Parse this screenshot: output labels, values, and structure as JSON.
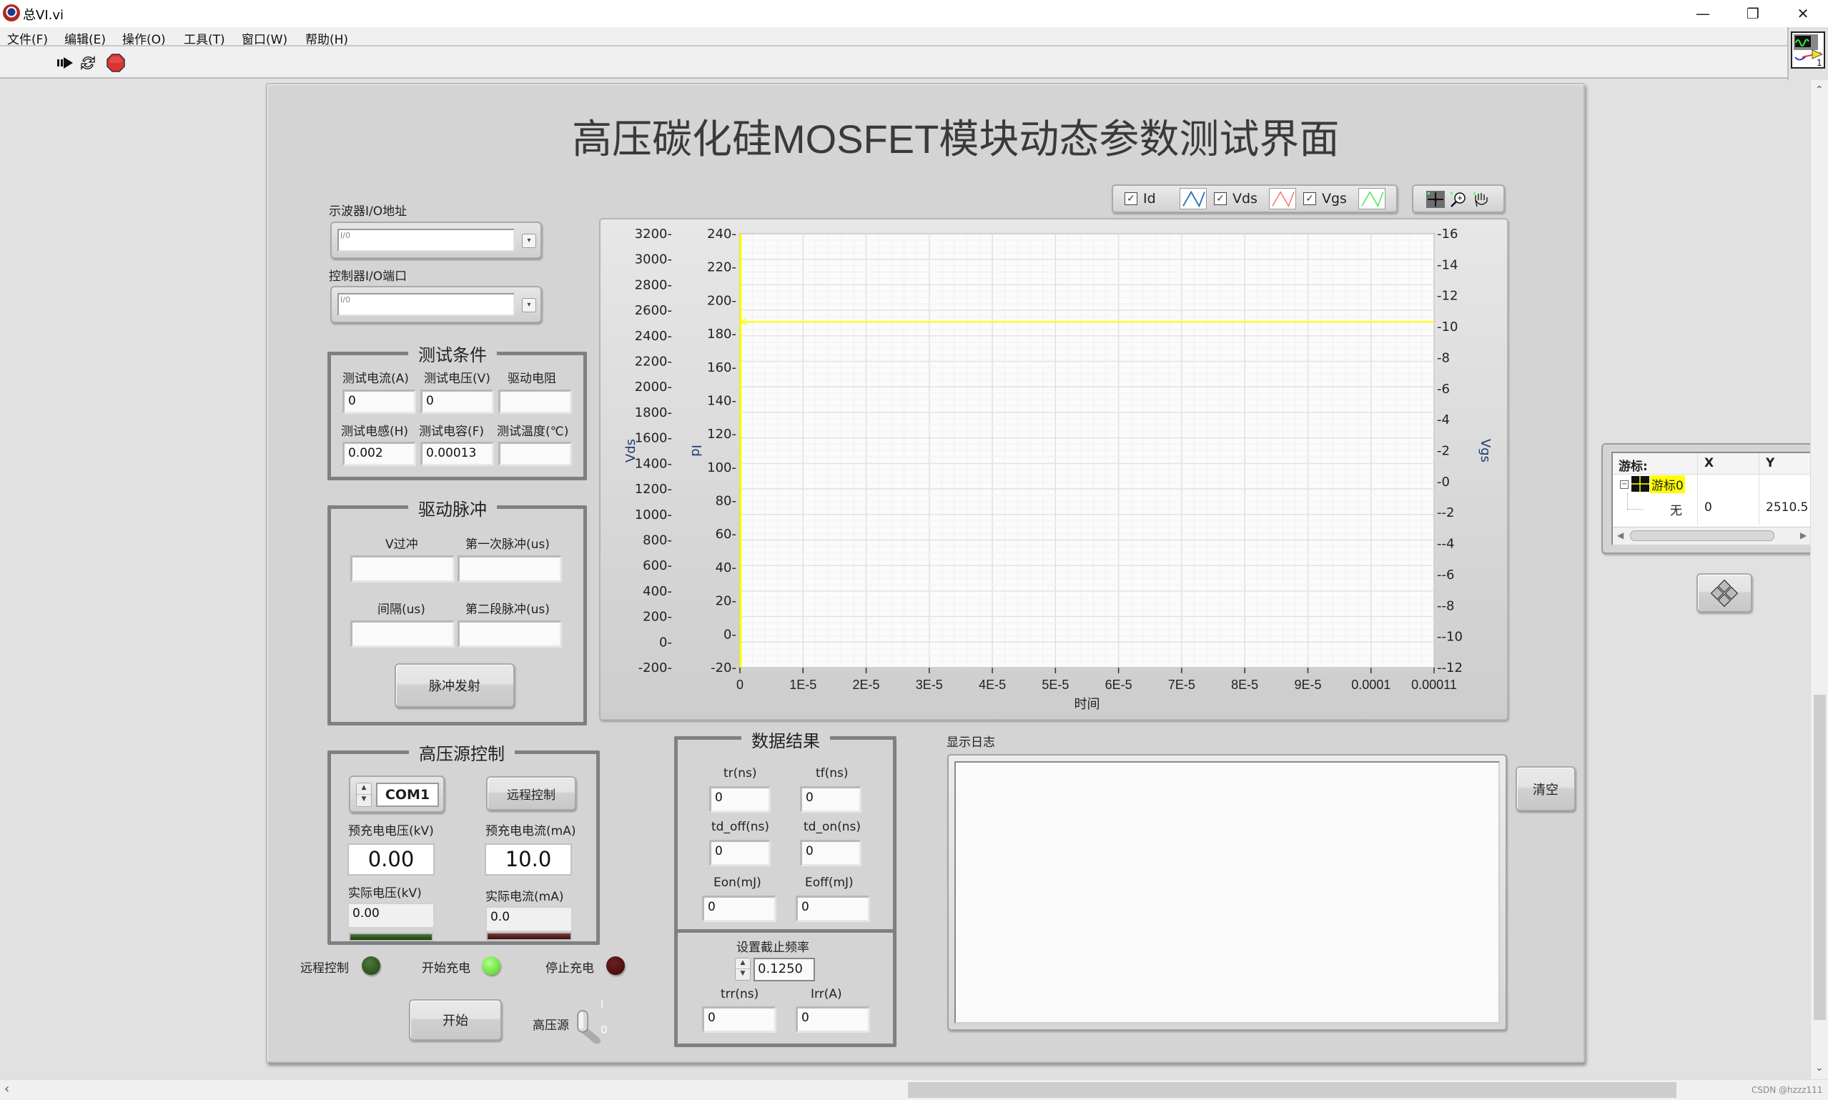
{
  "window": {
    "title": "总VI.vi",
    "controls": {
      "minimize": "—",
      "restore": "❐",
      "close": "✕"
    }
  },
  "menu": [
    "文件(F)",
    "编辑(E)",
    "操作(O)",
    "工具(T)",
    "窗口(W)",
    "帮助(H)"
  ],
  "toolbar": {
    "run_icon": "run-arrow-icon",
    "run_continuous_icon": "run-continuously-icon",
    "abort_icon": "abort-stop-icon"
  },
  "panel": {
    "title": "高压碳化硅MOSFET模块动态参数测试界面"
  },
  "io": {
    "scope_label": "示波器I/O地址",
    "scope_value": "",
    "controller_label": "控制器I/O端口",
    "controller_value": "",
    "io_glyph": "I/0"
  },
  "test_conditions": {
    "title": "测试条件",
    "fields": [
      {
        "label": "测试电流(A)",
        "value": "0"
      },
      {
        "label": "测试电压(V)",
        "value": "0"
      },
      {
        "label": "驱动电阻",
        "value": ""
      },
      {
        "label": "测试电感(H)",
        "value": "0.002"
      },
      {
        "label": "测试电容(F)",
        "value": "0.00013"
      },
      {
        "label": "测试温度(℃)",
        "value": ""
      }
    ]
  },
  "drive_pulse": {
    "title": "驱动脉冲",
    "fields": [
      {
        "label": "V过冲",
        "value": ""
      },
      {
        "label": "第一次脉冲(us)",
        "value": ""
      },
      {
        "label": "间隔(us)",
        "value": ""
      },
      {
        "label": "第二段脉冲(us)",
        "value": ""
      }
    ],
    "fire_button": "脉冲发射"
  },
  "hv_control": {
    "title": "高压源控制",
    "com_port": "COM1",
    "remote_button": "远程控制",
    "precharge_voltage_label": "预充电电压(kV)",
    "precharge_voltage": "0.00",
    "precharge_current_label": "预充电电流(mA)",
    "precharge_current": "10.0",
    "actual_voltage_label": "实际电压(kV)",
    "actual_voltage": "0.00",
    "actual_current_label": "实际电流(mA)",
    "actual_current": "0.0",
    "voltage_bar_fraction": 0,
    "current_bar_fraction": 0
  },
  "indicators": [
    {
      "label": "远程控制",
      "state": "off",
      "color": "#2e5a1e"
    },
    {
      "label": "开始充电",
      "state": "on",
      "color": "#5cf02a"
    },
    {
      "label": "停止充电",
      "state": "off",
      "color": "#4a1010"
    }
  ],
  "start_button": "开始",
  "hv_switch": {
    "label": "高压源",
    "on_label": "I",
    "off_label": "0",
    "state": "off"
  },
  "results": {
    "title": "数据结果",
    "fields": [
      {
        "label": "tr(ns)",
        "value": "0"
      },
      {
        "label": "tf(ns)",
        "value": "0"
      },
      {
        "label": "td_off(ns)",
        "value": "0"
      },
      {
        "label": "td_on(ns)",
        "value": "0"
      },
      {
        "label": "Eon(mJ)",
        "value": "0"
      },
      {
        "label": "Eoff(mJ)",
        "value": "0"
      }
    ],
    "cutoff_label": "设置截止频率",
    "cutoff_value": "0.1250",
    "trr_label": "trr(ns)",
    "trr_value": "0",
    "irr_label": "Irr(A)",
    "irr_value": "0"
  },
  "log": {
    "label": "显示日志",
    "content": "",
    "clear_button": "清空"
  },
  "legend": [
    {
      "name": "Id",
      "checked": true,
      "color": "#2f74b5"
    },
    {
      "name": "Vds",
      "checked": true,
      "color": "#ff6b6b"
    },
    {
      "name": "Vgs",
      "checked": true,
      "color": "#3ee63e"
    }
  ],
  "graph_tools": [
    "cursor-move-tool",
    "zoom-tool",
    "pan-hand-tool"
  ],
  "cursor_panel": {
    "header": [
      "游标:",
      "X",
      "Y"
    ],
    "cursor_name": "游标0",
    "row_label": "无",
    "x": "0",
    "y": "2510.5",
    "cursor_color": "#ffff00"
  },
  "chart_data": {
    "type": "line",
    "title": "",
    "xlabel": "时间",
    "xlim": [
      0,
      0.00011
    ],
    "x_ticks": [
      "0",
      "1E-5",
      "2E-5",
      "3E-5",
      "4E-5",
      "5E-5",
      "6E-5",
      "7E-5",
      "8E-5",
      "9E-5",
      "0.0001",
      "0.00011"
    ],
    "y_axes": [
      {
        "name": "Vds",
        "side": "left-outer",
        "ylim": [
          -200,
          3200
        ],
        "ticks": [
          "3200",
          "3000",
          "2800",
          "2600",
          "2400",
          "2200",
          "2000",
          "1800",
          "1600",
          "1400",
          "1200",
          "1000",
          "800",
          "600",
          "400",
          "200",
          "0",
          "-200"
        ]
      },
      {
        "name": "Id",
        "side": "left-inner",
        "ylim": [
          -20,
          240
        ],
        "ticks": [
          "240",
          "220",
          "200",
          "180",
          "160",
          "140",
          "120",
          "100",
          "80",
          "60",
          "40",
          "20",
          "0",
          "-20"
        ]
      },
      {
        "name": "Vgs",
        "side": "right",
        "ylim": [
          -12,
          16
        ],
        "ticks": [
          "16",
          "14",
          "12",
          "10",
          "8",
          "6",
          "4",
          "2",
          "0",
          "-2",
          "-4",
          "-6",
          "-8",
          "-10",
          "-12"
        ]
      }
    ],
    "series": [
      {
        "name": "Id",
        "values": []
      },
      {
        "name": "Vds",
        "values": []
      },
      {
        "name": "Vgs",
        "values": []
      }
    ],
    "cursor": {
      "name": "游标0",
      "x": 0,
      "y": 2510.5,
      "axis": "Vds",
      "color": "#ffff00"
    },
    "grid": true,
    "legend": "top-right"
  },
  "watermark": "CSDN @hzzz111"
}
